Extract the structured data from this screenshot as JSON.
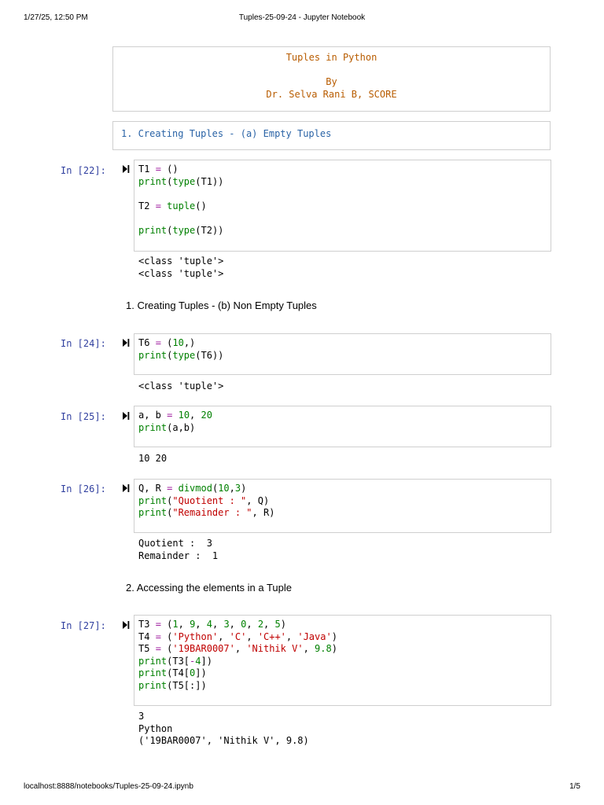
{
  "browser": {
    "datetime": "1/27/25, 12:50 PM",
    "page_title": "Tuples-25-09-24 - Jupyter Notebook",
    "url": "localhost:8888/notebooks/Tuples-25-09-24.ipynb",
    "page_number": "1/5"
  },
  "title_cell": {
    "line1": "Tuples in Python",
    "line2": "By",
    "line3": "Dr. Selva Rani B, SCORE"
  },
  "section1a": "1. Creating Tuples - (a) Empty Tuples",
  "section1b": "1. Creating Tuples - (b) Non Empty Tuples",
  "section2": "2. Accessing the elements in a Tuple",
  "cells": [
    {
      "prompt": "In [22]:",
      "outputs": [
        "<class 'tuple'>",
        "<class 'tuple'>"
      ]
    },
    {
      "prompt": "In [24]:",
      "outputs": [
        "<class 'tuple'>"
      ]
    },
    {
      "prompt": "In [25]:",
      "outputs": [
        "10 20"
      ]
    },
    {
      "prompt": "In [26]:",
      "outputs": [
        "Quotient :  3",
        "Remainder :  1"
      ]
    },
    {
      "prompt": "In [27]:",
      "outputs": [
        "3",
        "Python",
        "('19BAR0007', 'Nithik V', 9.8)"
      ]
    }
  ],
  "code": {
    "c22": {
      "l1_a": "T1 ",
      "l1_op": "=",
      "l1_b": " ()",
      "l2_fn": "print",
      "l2_a": "(",
      "l2_fn2": "type",
      "l2_b": "(T1))",
      "l4_a": "T2 ",
      "l4_op": "=",
      "l4_b": " ",
      "l4_fn": "tuple",
      "l4_c": "()",
      "l6_fn": "print",
      "l6_a": "(",
      "l6_fn2": "type",
      "l6_b": "(T2))"
    },
    "c24": {
      "l1_a": "T6 ",
      "l1_op": "=",
      "l1_b": " (",
      "l1_num": "10",
      "l1_c": ",)",
      "l2_fn": "print",
      "l2_a": "(",
      "l2_fn2": "type",
      "l2_b": "(T6))"
    },
    "c25": {
      "l1_a": "a, b ",
      "l1_op": "=",
      "l1_b": " ",
      "l1_n1": "10",
      "l1_c": ", ",
      "l1_n2": "20",
      "l2_fn": "print",
      "l2_a": "(a,b)"
    },
    "c26": {
      "l1_a": "Q, R ",
      "l1_op": "=",
      "l1_b": " ",
      "l1_fn": "divmod",
      "l1_c": "(",
      "l1_n1": "10",
      "l1_d": ",",
      "l1_n2": "3",
      "l1_e": ")",
      "l2_fn": "print",
      "l2_a": "(",
      "l2_s": "\"Quotient : \"",
      "l2_b": ", Q)",
      "l3_fn": "print",
      "l3_a": "(",
      "l3_s": "\"Remainder : \"",
      "l3_b": ", R)"
    },
    "c27": {
      "l1_a": "T3 ",
      "l1_op": "=",
      "l1_b": " (",
      "l1_nums": [
        "1",
        "9",
        "4",
        "3",
        "0",
        "2",
        "5"
      ],
      "l2_a": "T4 ",
      "l2_op": "=",
      "l2_b": " (",
      "l2_strs": [
        "'Python'",
        "'C'",
        "'C++'",
        "'Java'"
      ],
      "l3_a": "T5 ",
      "l3_op": "=",
      "l3_b": " (",
      "l3_s1": "'19BAR0007'",
      "l3_c": ", ",
      "l3_s2": "'Nithik V'",
      "l3_d": ", ",
      "l3_n": "9.8",
      "l3_e": ")",
      "l4_fn": "print",
      "l4_a": "(T3[",
      "l4_op": "-",
      "l4_n": "4",
      "l4_b": "])",
      "l5_fn": "print",
      "l5_a": "(T4[",
      "l5_n": "0",
      "l5_b": "])",
      "l6_fn": "print",
      "l6_a": "(T5[:])"
    }
  },
  "colors": {
    "prompt": "#303f9f",
    "title": "#b85c00",
    "section": "#2a63a6",
    "number": "#008000",
    "string": "#c00000",
    "operator": "#a020a0"
  },
  "icons": {
    "run": "run-cell-icon"
  }
}
